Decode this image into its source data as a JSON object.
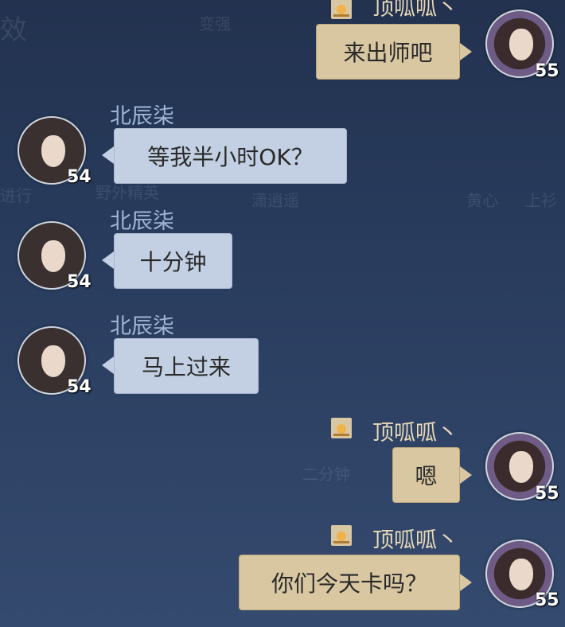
{
  "background_text": {
    "top_left_glyph": "效",
    "top_text": "变强",
    "faint_1": "进行",
    "faint_2": "野外精英",
    "faint_3": "潇逍遥",
    "faint_4": "上衫",
    "faint_5": "黄心",
    "faint_6": "二分钟"
  },
  "colors": {
    "self_bubble": "#d9c7a2",
    "other_bubble": "#c3d0e3",
    "other_name": "#9fb5d6",
    "self_name": "#e8d9b8"
  },
  "messages": [
    {
      "side": "right",
      "sender": "顶呱呱丶",
      "level": "55",
      "text": "来出师吧",
      "badge": "sun-icon"
    },
    {
      "side": "left",
      "sender": "北辰柒",
      "level": "54",
      "text": "等我半小时OK？"
    },
    {
      "side": "left",
      "sender": "北辰柒",
      "level": "54",
      "text": "十分钟"
    },
    {
      "side": "left",
      "sender": "北辰柒",
      "level": "54",
      "text": "马上过来"
    },
    {
      "side": "right",
      "sender": "顶呱呱丶",
      "level": "55",
      "text": "嗯",
      "badge": "sun-icon"
    },
    {
      "side": "right",
      "sender": "顶呱呱丶",
      "level": "55",
      "text": "你们今天卡吗？",
      "badge": "sun-icon"
    }
  ]
}
